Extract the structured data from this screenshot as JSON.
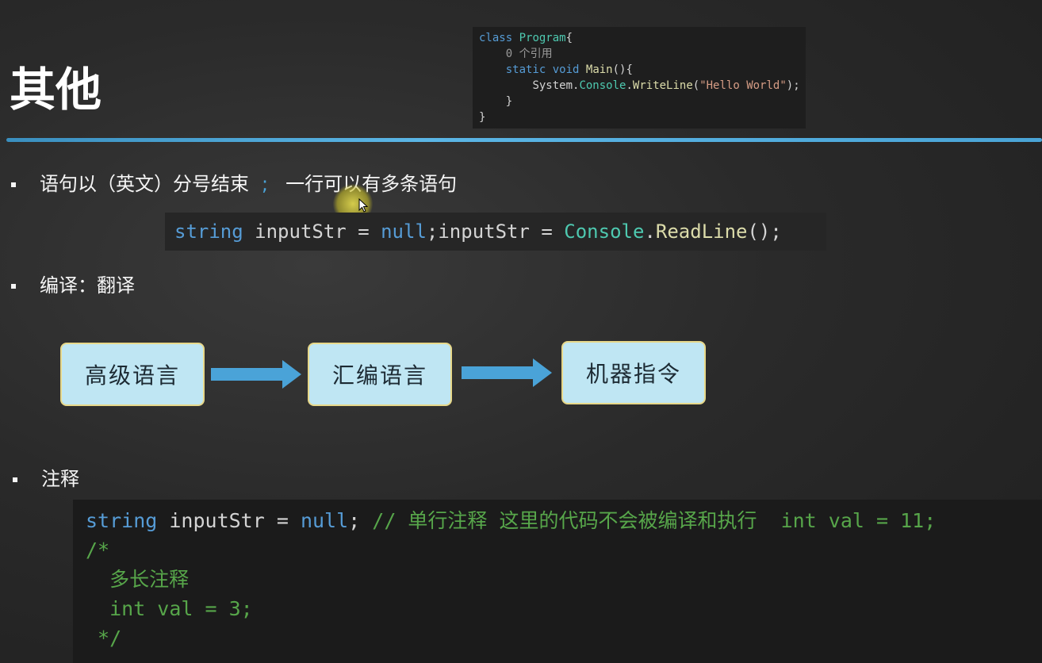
{
  "slide": {
    "title": "其他"
  },
  "snippet": {
    "line1_kw": "class",
    "line1_ty": "Program",
    "line1_brace": "{",
    "line2_ref": "0 个引用",
    "line3_kw1": "static",
    "line3_kw2": "void",
    "line3_fn": "Main",
    "line3_rest": "(){",
    "line4_a": "System",
    "line4_dot1": ".",
    "line4_ty": "Console",
    "line4_dot2": ".",
    "line4_fn": "WriteLine",
    "line4_open": "(",
    "line4_str": "\"Hello World\"",
    "line4_close": ");",
    "line5": "}",
    "line6": "}"
  },
  "bullet1": {
    "text_before": "语句以（英文）分号结束",
    "semicolon": ";",
    "text_after": "一行可以有多条语句"
  },
  "code1": {
    "t1": "string",
    "t2": " inputStr = ",
    "t3": "null",
    "t4": ";inputStr = ",
    "t5": "Console",
    "t6": ".",
    "t7": "ReadLine",
    "t8": "();"
  },
  "bullet2": {
    "text": "编译：翻译"
  },
  "flow": {
    "box1": "高级语言",
    "box2": "汇编语言",
    "box3": "机器指令"
  },
  "bullet3": {
    "text": "注释"
  },
  "code2": {
    "l1_kw": "string",
    "l1_mid": " inputStr = ",
    "l1_null": "null",
    "l1_semi": "; ",
    "l1_comment": "// 单行注释 这里的代码不会被编译和执行  int val = 11;",
    "l2": "/*",
    "l3": "  多长注释",
    "l4": "  int val = 3;",
    "l5": " */"
  },
  "colors": {
    "accent_blue": "#4aa3d8",
    "box_fill": "#bfe6f3",
    "comment_green": "#57a64a"
  }
}
